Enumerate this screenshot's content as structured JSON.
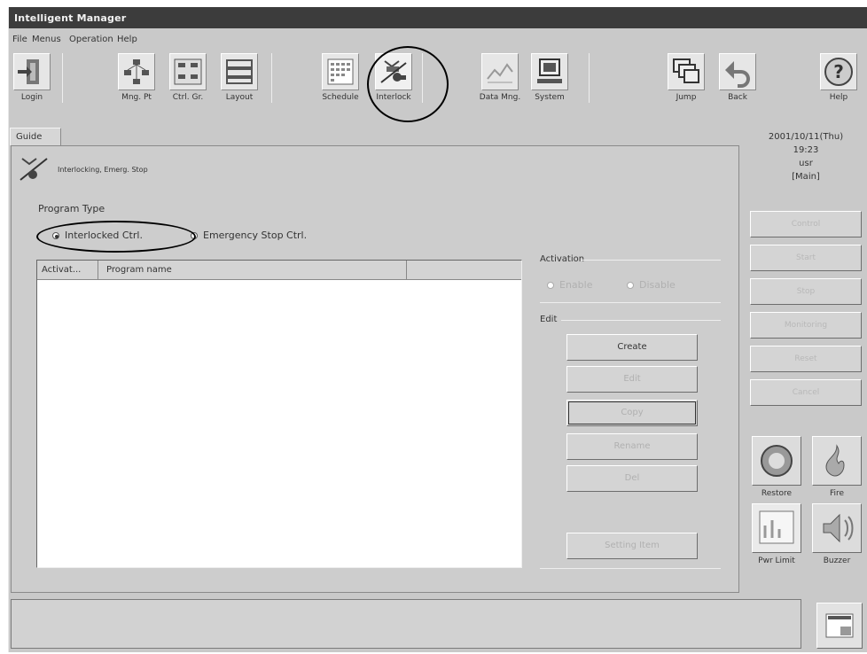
{
  "window": {
    "title": "Intelligent Manager"
  },
  "menu": {
    "items": [
      "File",
      "Menus",
      "Operation",
      "Help"
    ]
  },
  "toolbar": {
    "buttons": [
      {
        "label": "Login",
        "icon": "login-door-icon"
      },
      {
        "label": "Mng. Pt",
        "icon": "management-point-icon"
      },
      {
        "label": "Ctrl. Gr.",
        "icon": "control-group-icon"
      },
      {
        "label": "Layout",
        "icon": "layout-icon"
      },
      {
        "label": "Schedule",
        "icon": "schedule-calendar-icon"
      },
      {
        "label": "Interlock",
        "icon": "interlock-icon"
      },
      {
        "label": "Data Mng.",
        "icon": "data-management-icon"
      },
      {
        "label": "System",
        "icon": "system-computer-icon"
      },
      {
        "label": "Jump",
        "icon": "jump-windows-icon"
      },
      {
        "label": "Back",
        "icon": "back-arrow-icon"
      },
      {
        "label": "Help",
        "icon": "help-question-icon"
      }
    ]
  },
  "tab": {
    "label": "Guide"
  },
  "datetime": {
    "date": "2001/10/11(Thu)",
    "time": "19:23",
    "user": "usr",
    "mode": "[Main]"
  },
  "panel": {
    "title": "Interlocking, Emerg. Stop",
    "program_type_label": "Program Type",
    "radio_interlock": "Interlocked Ctrl.",
    "radio_emergency": "Emergency Stop Ctrl.",
    "columns": [
      "Activat...",
      "Program name"
    ],
    "activation_label": "Activation",
    "activation_on": "Enable",
    "activation_off": "Disable",
    "edit_label": "Edit",
    "edit_buttons": [
      {
        "label": "Create",
        "enabled": true
      },
      {
        "label": "Edit",
        "enabled": false
      },
      {
        "label": "Copy",
        "enabled": false,
        "focus": true
      },
      {
        "label": "Rename",
        "enabled": false
      },
      {
        "label": "Del",
        "enabled": false
      }
    ],
    "settings_button": "Setting Item"
  },
  "sidebar": {
    "buttons": [
      "Control",
      "Start",
      "Stop",
      "Monitoring",
      "Reset",
      "Cancel"
    ],
    "restore_label": "Restore",
    "fire_label": "Fire",
    "pwr_limit_label": "Pwr Limit",
    "buzzer_label": "Buzzer"
  },
  "colors": {
    "window_bg": "#c9c9c9",
    "titlebar": "#3c3c3c",
    "highlight_ring": "#000000"
  }
}
